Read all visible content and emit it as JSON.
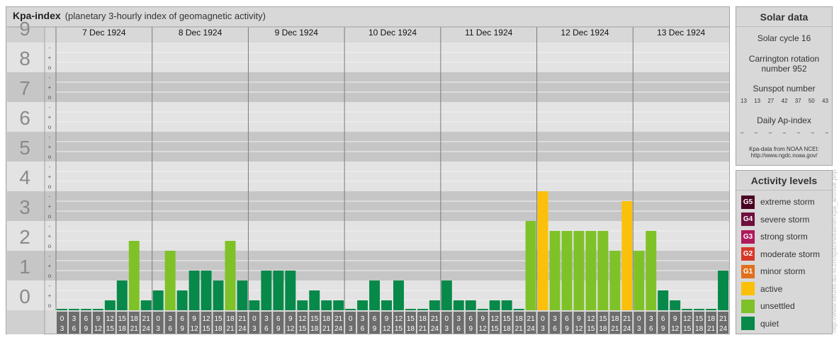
{
  "header": {
    "title": "Kpa-index",
    "subtitle": "(planetary 3-hourly index of geomagnetic activity)"
  },
  "chart_data": {
    "type": "bar",
    "title": "Kpa-index",
    "subtitle": "(planetary 3-hourly index of geomagnetic activity)",
    "ylim": [
      0,
      9
    ],
    "y_ticks": [
      "0",
      "1",
      "2",
      "3",
      "4",
      "5",
      "6",
      "7",
      "8",
      "9"
    ],
    "y_minor_ticks": [
      "o",
      "+",
      "-"
    ],
    "grid": true,
    "days": [
      "7 Dec 1924",
      "8 Dec 1924",
      "9 Dec 1924",
      "10 Dec 1924",
      "11 Dec 1924",
      "12 Dec 1924",
      "13 Dec 1924"
    ],
    "hour_labels": [
      [
        "0",
        "3"
      ],
      [
        "3",
        "6"
      ],
      [
        "6",
        "9"
      ],
      [
        "9",
        "12"
      ],
      [
        "12",
        "15"
      ],
      [
        "15",
        "18"
      ],
      [
        "18",
        "21"
      ],
      [
        "21",
        "24"
      ]
    ],
    "values": [
      [
        0.0,
        0.0,
        0.0,
        0.0,
        0.333,
        1.0,
        2.333,
        0.333
      ],
      [
        0.667,
        2.0,
        0.667,
        1.333,
        1.333,
        1.0,
        2.333,
        1.0
      ],
      [
        0.333,
        1.333,
        1.333,
        1.333,
        0.333,
        0.667,
        0.333,
        0.333
      ],
      [
        0.0,
        0.333,
        1.0,
        0.333,
        1.0,
        0.0,
        0.0,
        0.333
      ],
      [
        1.0,
        0.333,
        0.333,
        0.0,
        0.333,
        0.333,
        0.0,
        3.0
      ],
      [
        4.0,
        2.667,
        2.667,
        2.667,
        2.667,
        2.667,
        2.0,
        3.667
      ],
      [
        2.0,
        2.667,
        0.667,
        0.333,
        0.0,
        0.0,
        0.0,
        1.333
      ]
    ],
    "categories_legend": [
      "quiet",
      "unsettled",
      "active"
    ]
  },
  "solar": {
    "title": "Solar data",
    "cycle": "Solar cycle 16",
    "carrington_line1": "Carrington rotation",
    "carrington_line2": "number 952",
    "sunspot_label": "Sunspot number",
    "sunspot_values": [
      "13",
      "13",
      "27",
      "42",
      "37",
      "50",
      "43"
    ],
    "ap_label": "Daily Ap-index",
    "ap_values": [
      "–",
      "–",
      "–",
      "–",
      "–",
      "–",
      "–"
    ],
    "credit_line1": "Kpa-data from NOAA NCEI:",
    "credit_line2": "http://www.ngdc.noaa.gov/"
  },
  "activity": {
    "title": "Activity levels",
    "levels": [
      {
        "code": "G5",
        "label": "extreme storm",
        "color": "#4a0222"
      },
      {
        "code": "G4",
        "label": "severe storm",
        "color": "#6e0f3e"
      },
      {
        "code": "G3",
        "label": "strong storm",
        "color": "#b0195b"
      },
      {
        "code": "G2",
        "label": "moderate storm",
        "color": "#d6382a"
      },
      {
        "code": "G1",
        "label": "minor storm",
        "color": "#e0701e"
      },
      {
        "code": "",
        "label": "active",
        "color": "#fbc00a"
      },
      {
        "code": "",
        "label": "unsettled",
        "color": "#7ec228"
      },
      {
        "code": "",
        "label": "quiet",
        "color": "#07894a"
      }
    ]
  },
  "colors": {
    "quiet": "#07894a",
    "unsettled": "#7ec228",
    "active": "#fbc00a",
    "panel_bg": "#d8d8d8",
    "band_dark": "#c6c6c6",
    "band_light": "#e3e3e3"
  },
  "watermark": "http://www.fleuret-au-fil.ch/spaceweather/kpa_archive.php"
}
